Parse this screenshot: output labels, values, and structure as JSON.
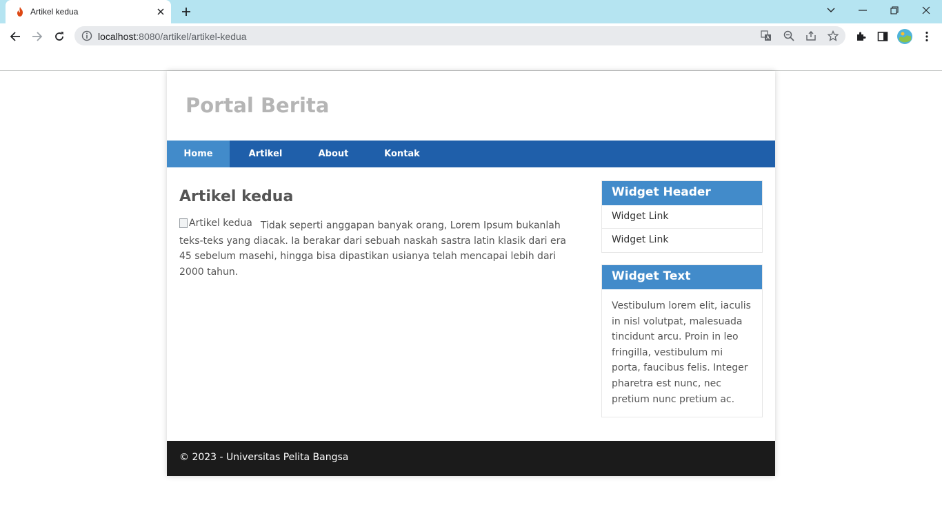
{
  "browser": {
    "tab_title": "Artikel kedua",
    "url_host": "localhost",
    "url_rest": ":8080/artikel/artikel-kedua",
    "accent": "#b5e4f1"
  },
  "site": {
    "title": "Portal Berita",
    "nav": [
      "Home",
      "Artikel",
      "About",
      "Kontak"
    ],
    "active_nav": "Home",
    "nav_color": "#1f5faa",
    "active_color": "#428bca"
  },
  "article": {
    "title": "Artikel kedua",
    "image_alt": "Artikel kedua",
    "body": "Tidak seperti anggapan banyak orang, Lorem Ipsum bukanlah teks-teks yang diacak. Ia berakar dari sebuah naskah sastra latin klasik dari era 45 sebelum masehi, hingga bisa dipastikan usianya telah mencapai lebih dari 2000 tahun."
  },
  "sidebar": {
    "widget1": {
      "header": "Widget Header",
      "links": [
        "Widget Link",
        "Widget Link"
      ]
    },
    "widget2": {
      "header": "Widget Text",
      "text": "Vestibulum lorem elit, iaculis in nisl volutpat, malesuada tincidunt arcu. Proin in leo fringilla, vestibulum mi porta, faucibus felis. Integer pharetra est nunc, nec pretium nunc pretium ac."
    }
  },
  "footer": {
    "text": "© 2023 - Universitas Pelita Bangsa"
  }
}
